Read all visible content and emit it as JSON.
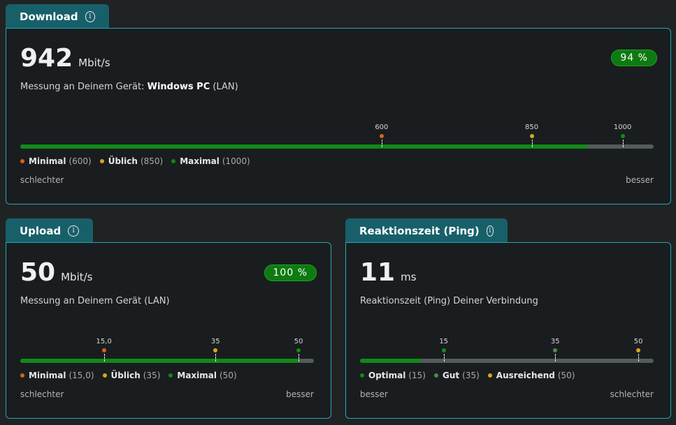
{
  "colors": {
    "tab": "#17606a",
    "panel_border": "#24a4b8",
    "green": "#118a17",
    "dark_green": "#0e7a12",
    "orange": "#d2651e",
    "yellow": "#d9a520",
    "gray_green": "#4f8a50"
  },
  "download": {
    "title": "Download",
    "info_icon": "info-icon",
    "value": "942",
    "unit": "Mbit/s",
    "badge": "94 %",
    "measure_prefix": "Messung an Deinem Gerät: ",
    "device": "Windows PC",
    "connection": " (LAN)",
    "fill_fraction": 0.896,
    "markers": [
      {
        "label": "600",
        "pos": 0.5705,
        "color": "#d2651e"
      },
      {
        "label": "850",
        "pos": 0.8075,
        "color": "#d9a520"
      },
      {
        "label": "1000",
        "pos": 0.951,
        "color": "#118a17"
      }
    ],
    "legend": [
      {
        "name": "Minimal",
        "value": "(600)",
        "color": "#d2651e"
      },
      {
        "name": "Üblich",
        "value": "(850)",
        "color": "#d9a520"
      },
      {
        "name": "Maximal",
        "value": "(1000)",
        "color": "#118a17"
      }
    ],
    "scale_left": "schlechter",
    "scale_right": "besser"
  },
  "upload": {
    "title": "Upload",
    "info_icon": "info-icon",
    "value": "50",
    "unit": "Mbit/s",
    "badge": "100 %",
    "measure": "Messung an Deinem Gerät (LAN)",
    "fill_fraction": 0.95,
    "markers": [
      {
        "label": "15,0",
        "pos": 0.285,
        "color": "#d2651e"
      },
      {
        "label": "35",
        "pos": 0.665,
        "color": "#d9a520"
      },
      {
        "label": "50",
        "pos": 0.948,
        "color": "#118a17"
      }
    ],
    "legend": [
      {
        "name": "Minimal",
        "value": "(15,0)",
        "color": "#d2651e"
      },
      {
        "name": "Üblich",
        "value": "(35)",
        "color": "#d9a520"
      },
      {
        "name": "Maximal",
        "value": "(50)",
        "color": "#118a17"
      }
    ],
    "scale_left": "schlechter",
    "scale_right": "besser"
  },
  "ping": {
    "title": "Reaktionszeit (Ping)",
    "info_icon": "info-icon",
    "value": "11",
    "unit": "ms",
    "measure": "Reaktionszeit (Ping) Deiner Verbindung",
    "fill_fraction": 0.21,
    "markers": [
      {
        "label": "15",
        "pos": 0.285,
        "color": "#118a17"
      },
      {
        "label": "35",
        "pos": 0.665,
        "color": "#4f8a50"
      },
      {
        "label": "50",
        "pos": 0.948,
        "color": "#d9a520"
      }
    ],
    "legend": [
      {
        "name": "Optimal",
        "value": "(15)",
        "color": "#118a17"
      },
      {
        "name": "Gut",
        "value": "(35)",
        "color": "#4f8a50"
      },
      {
        "name": "Ausreichend",
        "value": "(50)",
        "color": "#d9a520"
      }
    ],
    "scale_left": "besser",
    "scale_right": "schlechter"
  }
}
